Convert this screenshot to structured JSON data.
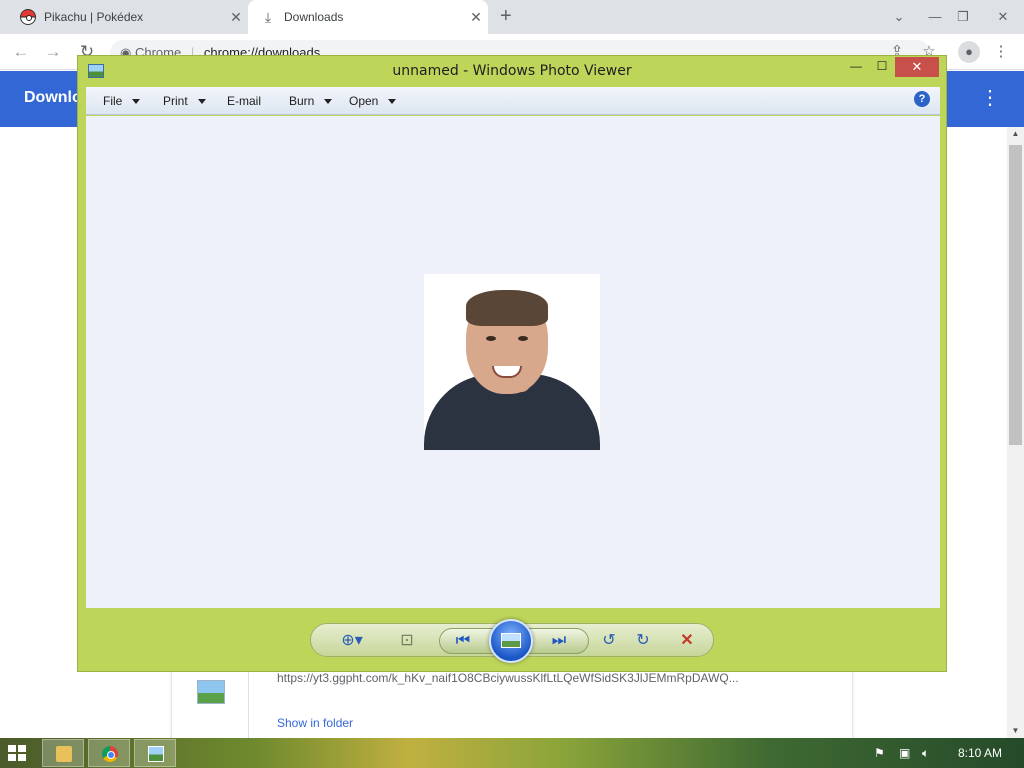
{
  "browser": {
    "tabs": [
      {
        "label": "Pikachu | Pokédex",
        "icon": "pokeball-icon"
      },
      {
        "label": "Downloads",
        "icon": "download-icon",
        "active": true
      }
    ],
    "omnibox": {
      "site_label": "Chrome",
      "separator": "|",
      "url": "chrome://downloads"
    },
    "page_title": "Downlo",
    "download_item": {
      "url": "https://yt3.ggpht.com/k_hKv_naif1O8CBciywussKlfLtLQeWfSidSK3JlJEMmRpDAWQ...",
      "action_label": "Show in folder"
    }
  },
  "photo_viewer": {
    "title": "unnamed - Windows Photo Viewer",
    "menu": [
      {
        "label": "File",
        "has_dropdown": true
      },
      {
        "label": "Print",
        "has_dropdown": true
      },
      {
        "label": "E-mail",
        "has_dropdown": false
      },
      {
        "label": "Burn",
        "has_dropdown": true
      },
      {
        "label": "Open",
        "has_dropdown": true
      }
    ],
    "help_label": "?",
    "accent_color": "#bdd65a",
    "close_color": "#c7504a"
  },
  "taskbar": {
    "time": "8:10 AM"
  }
}
